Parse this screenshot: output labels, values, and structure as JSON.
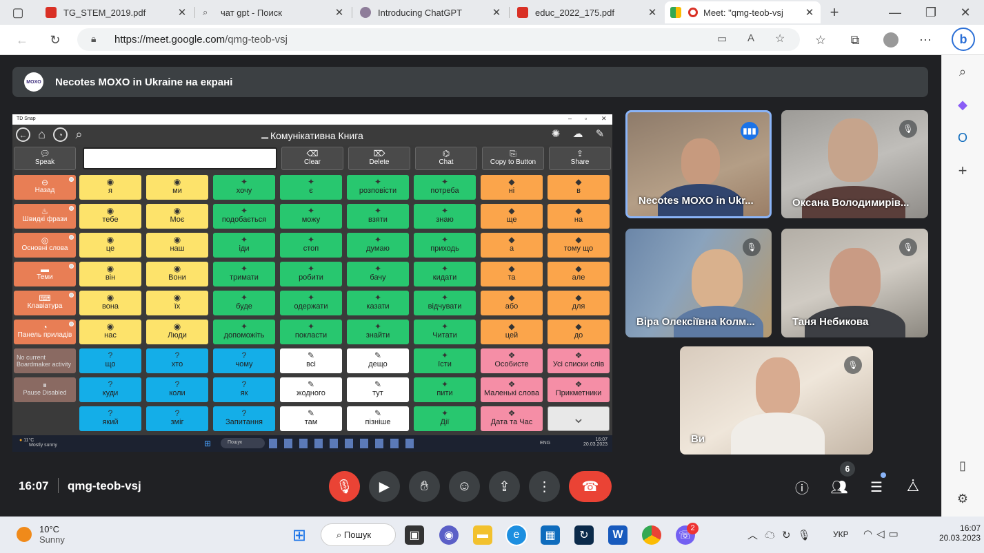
{
  "browser": {
    "tabs": [
      {
        "title": "TG_STEM_2019.pdf",
        "icon": "pdf-icon"
      },
      {
        "title": "чат gpt - Поиск",
        "icon": "search-icon"
      },
      {
        "title": "Introducing ChatGPT",
        "icon": "openai-icon"
      },
      {
        "title": "educ_2022_175.pdf",
        "icon": "pdf-icon"
      },
      {
        "title": "Meet: \"qmg-teob-vsj",
        "icon": "meet-icon",
        "active": true
      }
    ],
    "new_tab": "+",
    "url_host": "https://meet.google.com",
    "url_path": "/qmg-teob-vsj"
  },
  "banner": {
    "logo_text": "MOXO",
    "text": "Necotes MOXO in Ukraine на екрані"
  },
  "td_snap": {
    "window_title": "TD Snap",
    "book_title": "Комунікативна Книга",
    "message_text": "",
    "toolbar": [
      {
        "label": "Speak",
        "icon": "speech-bubble-icon"
      },
      {
        "label": "Clear",
        "icon": "clear-icon"
      },
      {
        "label": "Delete",
        "icon": "delete-icon"
      },
      {
        "label": "Chat",
        "icon": "chat-icon"
      },
      {
        "label": "Copy to Button",
        "icon": "copy-icon"
      },
      {
        "label": "Share",
        "icon": "share-icon"
      }
    ],
    "side": [
      {
        "label": "Назад",
        "icon": "back-icon"
      },
      {
        "label": "Швидкі фрази",
        "icon": "fire-icon"
      },
      {
        "label": "Основні слова",
        "icon": "target-icon"
      },
      {
        "label": "Теми",
        "icon": "topics-icon"
      },
      {
        "label": "Клавіатура",
        "icon": "keyboard-icon"
      },
      {
        "label": "Панель приладів",
        "icon": "dashboard-icon"
      },
      {
        "label": "No current Boardmaker activity",
        "icon": ""
      },
      {
        "label": "Pause Disabled",
        "icon": "pause-icon"
      }
    ],
    "grid": [
      [
        {
          "t": "я",
          "c": "y"
        },
        {
          "t": "ми",
          "c": "y"
        },
        {
          "t": "хочу",
          "c": "g"
        },
        {
          "t": "є",
          "c": "g"
        },
        {
          "t": "розповісти",
          "c": "g"
        },
        {
          "t": "потреба",
          "c": "g"
        },
        {
          "t": "ні",
          "c": "o"
        },
        {
          "t": "в",
          "c": "o"
        }
      ],
      [
        {
          "t": "тебе",
          "c": "y"
        },
        {
          "t": "Моє",
          "c": "y"
        },
        {
          "t": "подобається",
          "c": "g"
        },
        {
          "t": "можу",
          "c": "g"
        },
        {
          "t": "взяти",
          "c": "g"
        },
        {
          "t": "знаю",
          "c": "g"
        },
        {
          "t": "ще",
          "c": "o"
        },
        {
          "t": "на",
          "c": "o"
        }
      ],
      [
        {
          "t": "це",
          "c": "y"
        },
        {
          "t": "наш",
          "c": "y"
        },
        {
          "t": "іди",
          "c": "g"
        },
        {
          "t": "стоп",
          "c": "g"
        },
        {
          "t": "думаю",
          "c": "g"
        },
        {
          "t": "приходь",
          "c": "g"
        },
        {
          "t": "а",
          "c": "o"
        },
        {
          "t": "тому що",
          "c": "o"
        }
      ],
      [
        {
          "t": "він",
          "c": "y"
        },
        {
          "t": "Вони",
          "c": "y"
        },
        {
          "t": "тримати",
          "c": "g"
        },
        {
          "t": "робити",
          "c": "g"
        },
        {
          "t": "бачу",
          "c": "g"
        },
        {
          "t": "кидати",
          "c": "g"
        },
        {
          "t": "та",
          "c": "o"
        },
        {
          "t": "але",
          "c": "o"
        }
      ],
      [
        {
          "t": "вона",
          "c": "y"
        },
        {
          "t": "їх",
          "c": "y"
        },
        {
          "t": "буде",
          "c": "g"
        },
        {
          "t": "одержати",
          "c": "g"
        },
        {
          "t": "казати",
          "c": "g"
        },
        {
          "t": "відчувати",
          "c": "g"
        },
        {
          "t": "або",
          "c": "o"
        },
        {
          "t": "для",
          "c": "o"
        }
      ],
      [
        {
          "t": "нас",
          "c": "y"
        },
        {
          "t": "Люди",
          "c": "y"
        },
        {
          "t": "допоможіть",
          "c": "g"
        },
        {
          "t": "покласти",
          "c": "g"
        },
        {
          "t": "знайти",
          "c": "g"
        },
        {
          "t": "Читати",
          "c": "g"
        },
        {
          "t": "цей",
          "c": "o"
        },
        {
          "t": "до",
          "c": "o"
        }
      ],
      [
        {
          "t": "що",
          "c": "b"
        },
        {
          "t": "хто",
          "c": "b"
        },
        {
          "t": "чому",
          "c": "b"
        },
        {
          "t": "всі",
          "c": "w"
        },
        {
          "t": "дещо",
          "c": "w"
        },
        {
          "t": "їсти",
          "c": "g"
        },
        {
          "t": "Особисте",
          "c": "p"
        },
        {
          "t": "Усі списки слів",
          "c": "p"
        }
      ],
      [
        {
          "t": "куди",
          "c": "b"
        },
        {
          "t": "коли",
          "c": "b"
        },
        {
          "t": "як",
          "c": "b"
        },
        {
          "t": "жодного",
          "c": "w"
        },
        {
          "t": "тут",
          "c": "w"
        },
        {
          "t": "пити",
          "c": "g"
        },
        {
          "t": "Маленькі слова",
          "c": "p"
        },
        {
          "t": "Прикметники",
          "c": "p"
        }
      ],
      [
        {
          "t": "який",
          "c": "b"
        },
        {
          "t": "зміг",
          "c": "b"
        },
        {
          "t": "Запитання",
          "c": "b"
        },
        {
          "t": "там",
          "c": "w"
        },
        {
          "t": "пізніше",
          "c": "w"
        },
        {
          "t": "Дії",
          "c": "g"
        },
        {
          "t": "Дата та Час",
          "c": "p"
        },
        {
          "t": "",
          "c": "gray"
        }
      ]
    ],
    "taskbar": {
      "weather": "11°C",
      "weather_desc": "Mostly sunny",
      "search": "Пошук",
      "lang": "ENG",
      "time": "16:07",
      "date": "20.03.2023"
    }
  },
  "participants": [
    {
      "name": "Necotes MOXO in Ukr...",
      "speaking": true
    },
    {
      "name": "Оксана Володимирів...",
      "speaking": false
    },
    {
      "name": "Віра Олексіївна Колм...",
      "speaking": false
    },
    {
      "name": "Таня Небикова",
      "speaking": false
    },
    {
      "name": "Ви",
      "speaking": false
    }
  ],
  "meeting": {
    "time": "16:07",
    "code": "qmg-teob-vsj",
    "people_count": "6"
  },
  "windows": {
    "weather_temp": "10°C",
    "weather_desc": "Sunny",
    "search": "Пошук",
    "lang": "УКР",
    "time": "16:07",
    "date": "20.03.2023",
    "viber_badge": "2"
  },
  "colors": {
    "meet_bg": "#202124",
    "end_call": "#ea4335",
    "mic_off": "#ea4335",
    "speaking_border": "#8ab4f8"
  }
}
